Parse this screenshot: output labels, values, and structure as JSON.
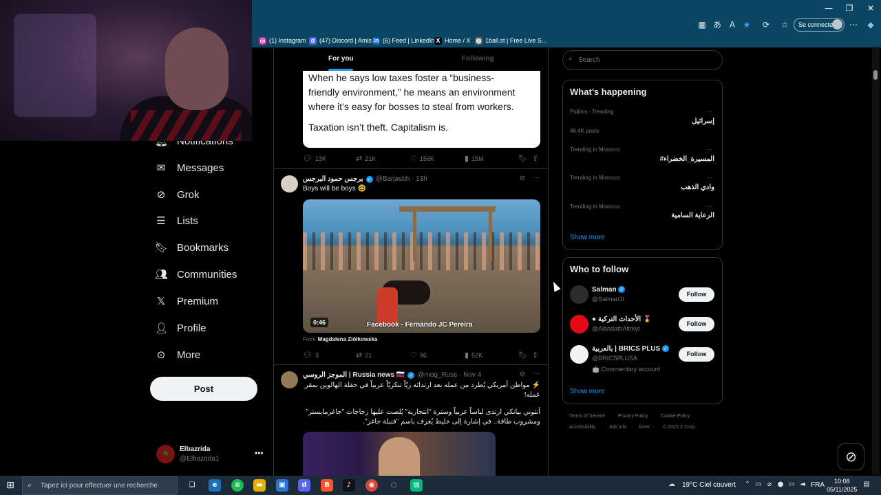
{
  "browser": {
    "window_controls": [
      "—",
      "❐",
      "✕"
    ],
    "account_button": "Se connecter",
    "bookmarks": [
      {
        "label": "(1) Instagram",
        "icon": "instagram-icon",
        "color": "#d6249f"
      },
      {
        "label": "(47) Discord | Amis",
        "icon": "discord-icon",
        "color": "#5865f2"
      },
      {
        "label": "(6) Feed | LinkedIn",
        "icon": "linkedin-icon",
        "color": "#0a66c2"
      },
      {
        "label": "Home / X",
        "icon": "x-icon",
        "color": "#000000"
      },
      {
        "label": "1ball.st | Free Live S...",
        "icon": "globe-icon",
        "color": "#5f6b75"
      }
    ]
  },
  "nav": {
    "items": [
      {
        "label": "Notifications",
        "icon": "bell-icon"
      },
      {
        "label": "Messages",
        "icon": "envelope-icon"
      },
      {
        "label": "Grok",
        "icon": "grok-icon"
      },
      {
        "label": "Lists",
        "icon": "list-icon"
      },
      {
        "label": "Bookmarks",
        "icon": "bookmark-icon"
      },
      {
        "label": "Communities",
        "icon": "people-icon"
      },
      {
        "label": "Premium",
        "icon": "x-logo-icon"
      },
      {
        "label": "Profile",
        "icon": "person-icon"
      },
      {
        "label": "More",
        "icon": "more-circle-icon"
      }
    ],
    "post_label": "Post",
    "account": {
      "name": "Elbazrida",
      "handle": "@Elbazrida1",
      "more": "•••"
    }
  },
  "feed": {
    "tabs": [
      "For you",
      "Following"
    ],
    "tweet1": {
      "quote_lines": [
        "When he says low taxes foster a “business-",
        "friendly environment,” he means an environment",
        "where it’s easy for bosses to steal from workers."
      ],
      "quote_last": "Taxation isn’t theft. Capitalism is.",
      "stats": {
        "replies": "13K",
        "reposts": "21K",
        "likes": "156K",
        "views": "15M"
      }
    },
    "tweet2": {
      "name": "برجس حمود البرجس",
      "handle": "@Barjasbh · 13h",
      "text": "Boys will be boys 🤓",
      "video_duration": "0:46",
      "video_watermark": "Facebook - Fernando JC Pereira",
      "from_prefix": "From",
      "from_name": "Magdalena Ziółkowska",
      "stats": {
        "replies": "3",
        "reposts": "21",
        "likes": "96",
        "views": "52K"
      }
    },
    "tweet3": {
      "name": "الموجز الروسي | Russia news 🇷🇺",
      "handle": "@mog_Russ · Nov 4",
      "text1": "⚡️ مواطن أمريكي يُطرد من عمله بعد ارتدائه زيّاً تنكريّاً عربياً في حفلة الهالوين بمقر عمله!",
      "text2": "أنتوني بيانكي ارتدى لباساً عربياً وسترة \"انتحارية\" يُلصت عليها زجاجات \"جاغرمايستر\" ومشروب طاقة.. في إشارة إلى خليط يُعرف باسم \"قنبلة جاغر\"."
    }
  },
  "sidebar": {
    "search_placeholder": "Search",
    "happening": {
      "title": "What’s happening",
      "trends": [
        {
          "category": "Politics · Trending",
          "name": "إسرائيل",
          "posts": "46.4K posts"
        },
        {
          "category": "Trending in Morocco",
          "name": "#المسيرة_الخضراء",
          "posts": ""
        },
        {
          "category": "Trending in Morocco",
          "name": "وادي الذهب",
          "posts": ""
        },
        {
          "category": "Trending in Morocco",
          "name": "الرعاية السامية",
          "posts": ""
        }
      ],
      "show_more": "Show more"
    },
    "who_to_follow": {
      "title": "Who to follow",
      "accounts": [
        {
          "name": "Salman",
          "handle": "@Salman1l",
          "extra": ""
        },
        {
          "name": "● الأحداث التركية 🎖️",
          "handle": "@AlahdathAltrkyt",
          "extra": ""
        },
        {
          "name": "بالعربية | BRICS PLUS",
          "handle": "@BRICSPLUSA",
          "extra": "🤖 Commentary account"
        }
      ],
      "follow_label": "Follow",
      "show_more": "Show more"
    },
    "footer": [
      "Terms of Service",
      "Privacy Policy",
      "Cookie Policy",
      "Accessibility",
      "Ads info",
      "More ···",
      "© 2025 X Corp."
    ]
  },
  "taskbar": {
    "search_placeholder": "Tapez ici pour effectuer une recherche",
    "weather": "19°C  Ciel couvert",
    "language": "FRA",
    "time": "10:08",
    "date": "05/11/2025"
  }
}
